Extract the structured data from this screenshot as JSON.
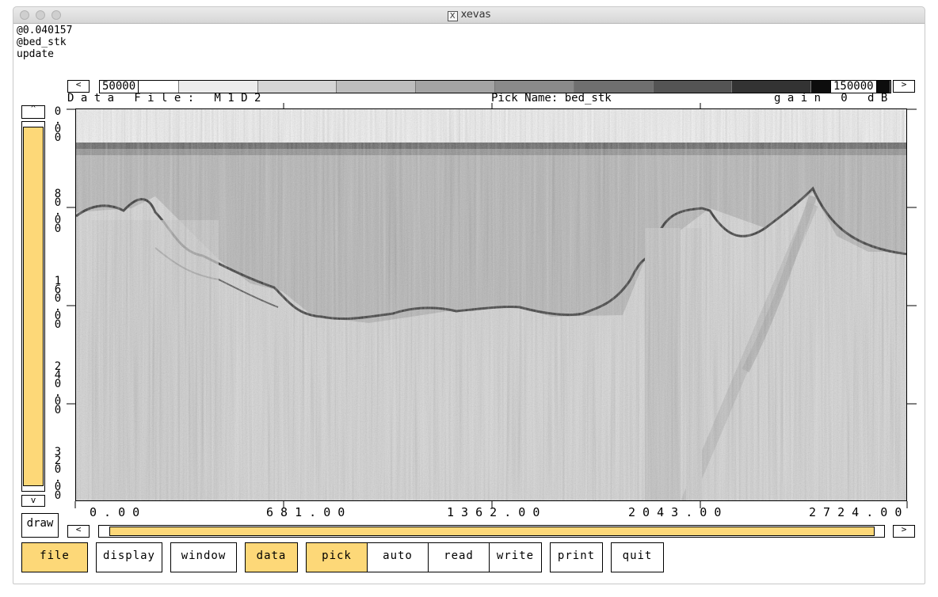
{
  "window": {
    "title": "xevas"
  },
  "messages": [
    "@0.040157",
    "@bed_stk",
    "update"
  ],
  "colorbar": {
    "min_label": "50000",
    "max_label": "150000",
    "left_arrow": "<",
    "right_arrow": ">"
  },
  "header": {
    "data_file": "D a t a   F i l e :   M 1 D 2",
    "pick_name": "Pick Name: bed_stk",
    "gain": "g a i n   0   d B"
  },
  "y_axis": {
    "ticks": [
      {
        "chars": [
          "0",
          ".",
          "0",
          "0"
        ]
      },
      {
        "chars": [
          "8",
          "0",
          ".",
          "0",
          "0"
        ]
      },
      {
        "chars": [
          "1",
          "6",
          "0",
          ".",
          "0",
          "0"
        ]
      },
      {
        "chars": [
          "2",
          "4",
          "0",
          ".",
          "0",
          "0"
        ]
      },
      {
        "chars": [
          "3",
          "2",
          "0",
          ".",
          "0",
          "0"
        ]
      }
    ],
    "scroll_up": "^",
    "scroll_down": "v"
  },
  "x_axis": {
    "ticks": [
      "0 . 0 0",
      "6 8 1 . 0 0",
      "1 3 6 2 . 0 0",
      "2 0 4 3 . 0 0",
      "2 7 2 4 . 0 0"
    ]
  },
  "hscroll": {
    "left_arrow": "<",
    "right_arrow": ">"
  },
  "draw_label": "draw",
  "buttons": {
    "file": "file",
    "display": "display",
    "window": "window",
    "data": "data",
    "pick": "pick",
    "auto": "auto",
    "read": "read",
    "write": "write",
    "print": "print",
    "quit": "quit"
  },
  "colors": {
    "accent": "#fdd878",
    "toggle_on": "#fdd878"
  }
}
